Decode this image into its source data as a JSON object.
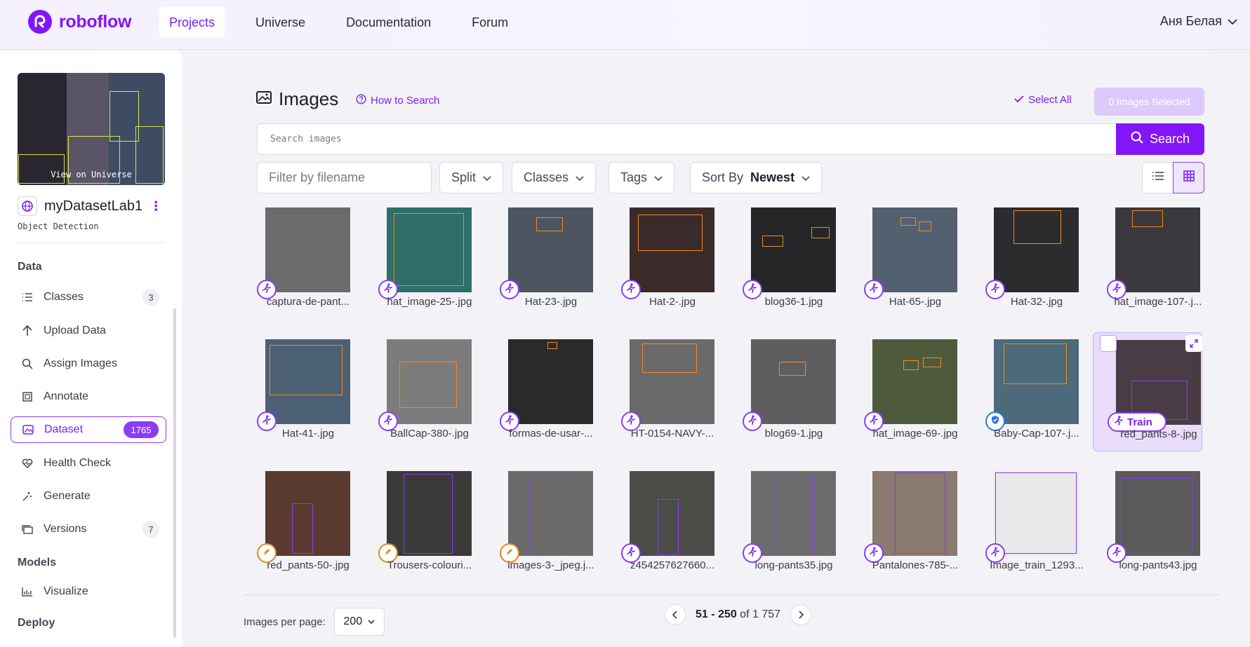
{
  "brand": {
    "name": "roboflow",
    "color": "#8315f9"
  },
  "nav": {
    "items": [
      {
        "label": "Projects",
        "active": true
      },
      {
        "label": "Universe"
      },
      {
        "label": "Documentation"
      },
      {
        "label": "Forum"
      }
    ]
  },
  "user": {
    "name": "Аня Белая"
  },
  "sidebar": {
    "thumbnail_label": "View on Universe",
    "dataset_name": "myDatasetLab1",
    "dataset_type": "Object Detection",
    "sections": {
      "data": "Data",
      "models": "Models",
      "deploy": "Deploy"
    },
    "items": [
      {
        "label": "Classes",
        "icon": "list-icon",
        "count": "3"
      },
      {
        "label": "Upload Data",
        "icon": "arrow-up-icon"
      },
      {
        "label": "Assign Images",
        "icon": "search-icon"
      },
      {
        "label": "Annotate",
        "icon": "annotate-icon"
      },
      {
        "label": "Dataset",
        "icon": "images-icon",
        "count": "1765",
        "active": true
      },
      {
        "label": "Health Check",
        "icon": "heart-pulse-icon"
      },
      {
        "label": "Generate",
        "icon": "generate-icon"
      },
      {
        "label": "Versions",
        "icon": "versions-icon",
        "count": "7"
      },
      {
        "label": "Visualize",
        "icon": "chart-icon"
      }
    ]
  },
  "main": {
    "title": "Images",
    "how_to_search": "How to Search",
    "select_all": "Select All",
    "selected_count": "0 Images Selected",
    "search_placeholder": "Search images",
    "search_button": "Search",
    "filename_placeholder": "Filter by filename",
    "filters": {
      "split": "Split",
      "classes": "Classes",
      "tags": "Tags",
      "sort_label": "Sort By",
      "sort_value": "Newest"
    }
  },
  "images": [
    {
      "name": "captura-de-pant...",
      "badge": "unassigned"
    },
    {
      "name": "hat_image-25-.jpg",
      "badge": "unassigned"
    },
    {
      "name": "Hat-23-.jpg",
      "badge": "unassigned"
    },
    {
      "name": "Hat-2-.jpg",
      "badge": "unassigned"
    },
    {
      "name": "blog36-1.jpg",
      "badge": "unassigned"
    },
    {
      "name": "Hat-65-.jpg",
      "badge": "unassigned"
    },
    {
      "name": "Hat-32-.jpg",
      "badge": "unassigned"
    },
    {
      "name": "hat_image-107-.j...",
      "badge": "unassigned"
    },
    {
      "name": "Hat-41-.jpg",
      "badge": "unassigned"
    },
    {
      "name": "BallCap-380-.jpg",
      "badge": "unassigned"
    },
    {
      "name": "formas-de-usar-...",
      "badge": "unassigned"
    },
    {
      "name": "HT-0154-NAVY-...",
      "badge": "unassigned"
    },
    {
      "name": "blog69-1.jpg",
      "badge": "unassigned"
    },
    {
      "name": "hat_image-69-.jpg",
      "badge": "unassigned"
    },
    {
      "name": "Baby-Cap-107-.j...",
      "badge": "approved"
    },
    {
      "name": "red_pants-8-.jpg",
      "badge": "train",
      "badge_label": "Train",
      "selected": true
    },
    {
      "name": "red_pants-50-.jpg",
      "badge": "annotating"
    },
    {
      "name": "Trousers-colouri...",
      "badge": "annotating"
    },
    {
      "name": "images-3-_jpeg.j...",
      "badge": "annotating"
    },
    {
      "name": "z454257627660...",
      "badge": "unassigned"
    },
    {
      "name": "long-pants35.jpg",
      "badge": "unassigned"
    },
    {
      "name": "Pantalones-785-...",
      "badge": "unassigned"
    },
    {
      "name": "Image_train_1293...",
      "badge": "unassigned"
    },
    {
      "name": "long-pants43.jpg",
      "badge": "unassigned"
    }
  ],
  "footer": {
    "per_page_label": "Images per page:",
    "per_page_value": "200",
    "range": "51 - 250",
    "of_label": "of",
    "total": "1 757"
  }
}
